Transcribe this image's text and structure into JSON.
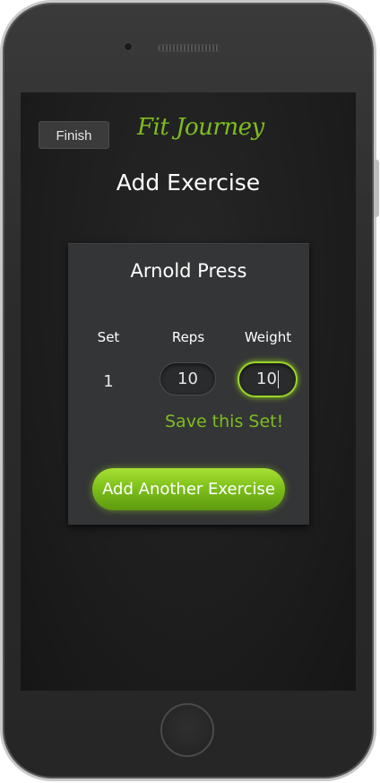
{
  "header": {
    "finish_label": "Finish",
    "app_title": "Fit Journey",
    "page_heading": "Add Exercise"
  },
  "exercise_card": {
    "exercise_name": "Arnold Press",
    "columns": {
      "set": "Set",
      "reps": "Reps",
      "weight": "Weight"
    },
    "set_number": "1",
    "reps_value": "10",
    "weight_value": "10",
    "save_set_label": "Save this Set!",
    "add_another_label": "Add Another Exercise"
  },
  "colors": {
    "accent_green": "#7ebd1f",
    "focus_glow": "#9bd42a",
    "card_background": "#343536",
    "screen_background": "#1d1d1d"
  }
}
